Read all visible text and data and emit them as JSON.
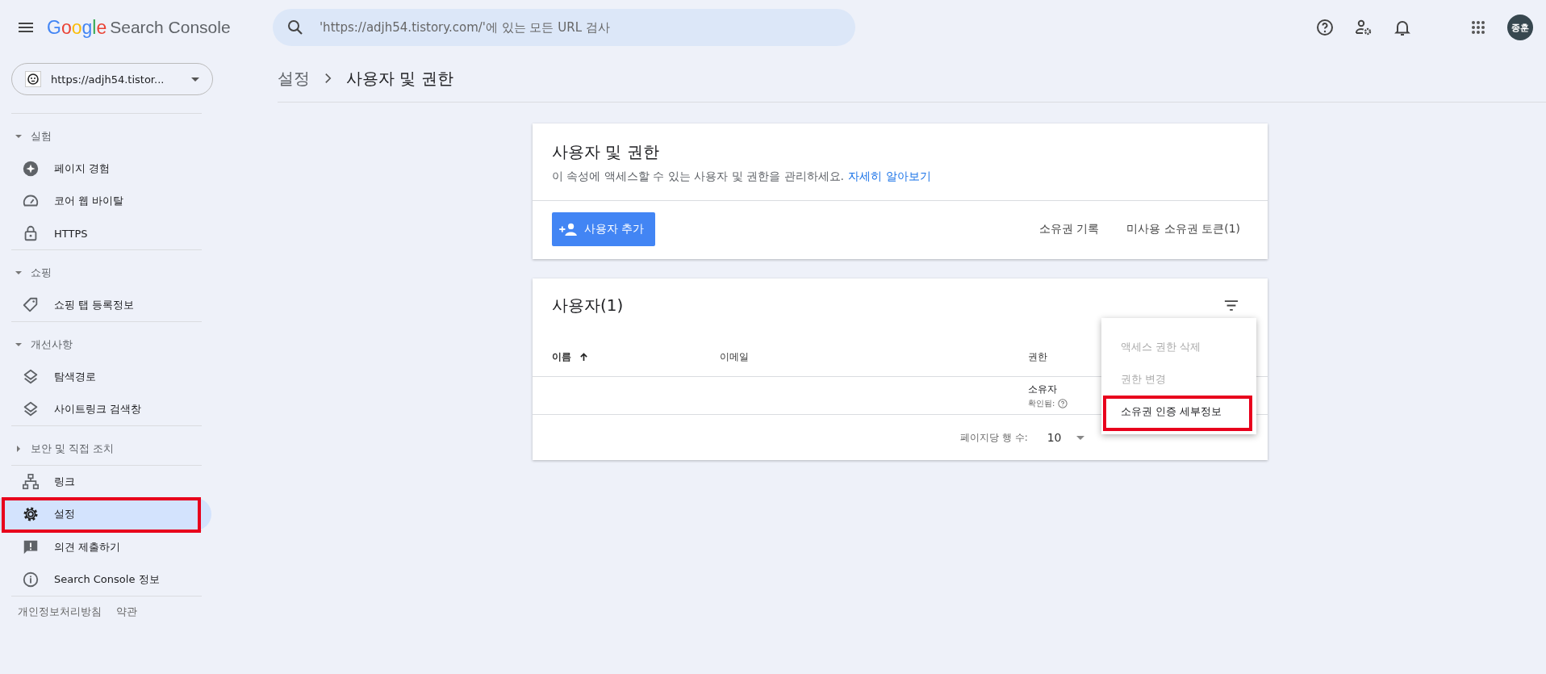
{
  "app_bar": {
    "brand": "Google",
    "product": "Search Console",
    "search": {
      "placeholder": "'https://adjh54.tistory.com/'에 있는 모든 URL 검사"
    },
    "avatar": "종훈"
  },
  "property_selector": {
    "value": "https://adjh54.tistor..."
  },
  "breadcrumb": [
    "설정",
    "사용자 및 권한"
  ],
  "sidebar": {
    "groups": [
      {
        "kind": "section",
        "label": "실험",
        "expanded": true,
        "items": [
          {
            "label": "페이지 경험",
            "selected": false,
            "highlighted": false
          },
          {
            "label": "코어 웹 바이탈",
            "selected": false,
            "highlighted": false
          },
          {
            "label": "HTTPS",
            "selected": false,
            "highlighted": false
          }
        ]
      },
      {
        "kind": "section",
        "label": "쇼핑",
        "expanded": true,
        "items": [
          {
            "label": "쇼핑 탭 등록정보",
            "selected": false,
            "highlighted": false
          }
        ]
      },
      {
        "kind": "section",
        "label": "개선사항",
        "expanded": true,
        "items": [
          {
            "label": "탐색경로",
            "selected": false,
            "highlighted": false
          },
          {
            "label": "사이트링크 검색창",
            "selected": false,
            "highlighted": false
          }
        ]
      },
      {
        "kind": "section",
        "label": "보안 및 직접 조치",
        "expanded": false
      },
      {
        "kind": "plain",
        "items": [
          {
            "label": "링크",
            "selected": false,
            "highlighted": false
          },
          {
            "label": "설정",
            "selected": true,
            "highlighted": true
          }
        ]
      },
      {
        "kind": "plain",
        "items": [
          {
            "label": "의견 제출하기",
            "selected": false,
            "highlighted": false
          },
          {
            "label": "Search Console 정보",
            "selected": false,
            "highlighted": false
          }
        ]
      }
    ],
    "footer_links": [
      "개인정보처리방침",
      "약관"
    ]
  },
  "permissions_card": {
    "title": "사용자 및 권한",
    "description": "이 속성에 액세스할 수 있는 사용자 및 권한을 관리하세요.",
    "learn_more": "자세히 알아보기",
    "add_button": "사용자 추가",
    "links": [
      "소유권 기록",
      "미사용 소유권 토큰(1)"
    ]
  },
  "users_card": {
    "title": "사용자(1)",
    "columns": [
      {
        "label": "이름",
        "sorted": true
      },
      {
        "label": "이메일",
        "sorted": false
      },
      {
        "label": "권한",
        "sorted": false
      }
    ],
    "rows": [
      {
        "role": "소유자",
        "status": "확인됨:"
      }
    ],
    "rows_per_page_label": "페이지당 행 수:",
    "rows_per_page": "10",
    "menu": [
      {
        "label": "액세스 권한 삭제",
        "disabled": true,
        "highlighted": false
      },
      {
        "label": "권한 변경",
        "disabled": true,
        "highlighted": false
      },
      {
        "label": "소유권 인증 세부정보",
        "disabled": false,
        "highlighted": true
      }
    ]
  }
}
